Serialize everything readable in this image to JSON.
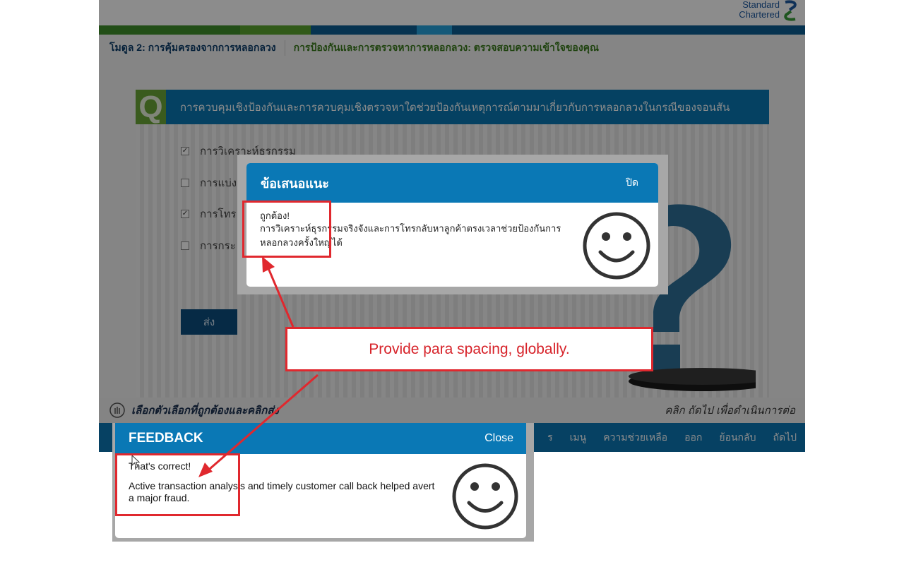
{
  "colors": {
    "brand_blue": "#0a78b5",
    "brand_green": "#6aa738",
    "annotation_red": "#e0282e",
    "logo_blue": "#1e5aa0"
  },
  "course": {
    "logo_line1": "Standard",
    "logo_line2": "Chartered",
    "logo_icon": "standard-chartered-logo",
    "module_title": "โมดูล 2: การคุ้มครองจากการหลอกลวง",
    "topic_title": "การป้องกันและการตรวจหาการหลอกลวง: ตรวจสอบความเข้าใจของคุณ",
    "question_badge": "Q",
    "question_text": "การควบคุมเชิงป้องกันและการควบคุมเชิงตรวจหาใดช่วยป้องกันเหตุการณ์ตามมาเกี่ยวกับการหลอกลวงในกรณีของจอนสัน",
    "options": [
      {
        "label": "การวิเคราะห์ธุรกรรม",
        "checked": true
      },
      {
        "label": "การแบ่ง",
        "checked": false
      },
      {
        "label": "การโทร",
        "checked": true
      },
      {
        "label": "การกระ",
        "checked": false
      }
    ],
    "submit_label": "ส่ง",
    "instruction_left": "เลือกตัวเลือกที่ถูกต้องและคลิกส่ง",
    "instruction_right": "คลิก ถัดไป เพื่อดำเนินการต่อ",
    "nav": {
      "resources": "ร",
      "menu": "เมนู",
      "help": "ความช่วยเหลือ",
      "exit": "ออก",
      "back": "ย้อนกลับ",
      "next": "ถัดไป"
    }
  },
  "thai_feedback": {
    "title": "ข้อเสนอแนะ",
    "close_label": "ปิด",
    "correct_text": "ถูกต้อง!",
    "message": "การวิเคราะห์ธุรกรรมจริงจังและการโทรกลับหาลูกค้าตรงเวลาช่วยป้องกันการหลอกลวงครั้งใหญ่ได้",
    "icon": "smiley-icon"
  },
  "english_feedback": {
    "title": "FEEDBACK",
    "close_label": "Close",
    "correct_text": "That's correct!",
    "message": "Active transaction analysis and timely customer call back helped avert a major fraud.",
    "icon": "smiley-icon"
  },
  "annotation": {
    "note": "Provide para spacing, globally."
  }
}
